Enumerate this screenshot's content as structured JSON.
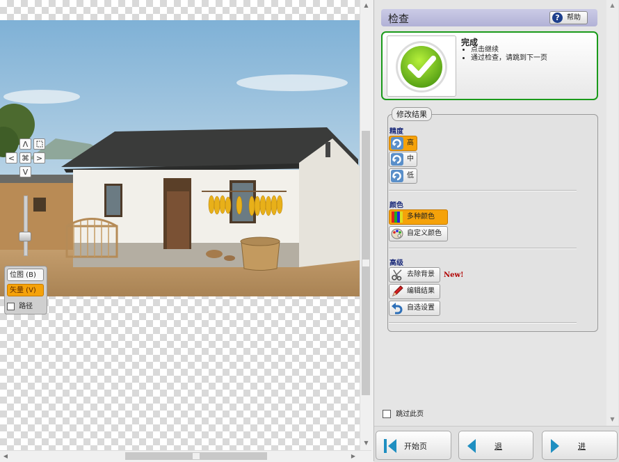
{
  "canvas": {
    "zoom_controls": {
      "up": "Λ",
      "down": "V",
      "left": "<",
      "right": ">",
      "center": "⌘"
    },
    "mode_panel": {
      "bitmap_label": "位图 (B)",
      "vector_label": "矢量 (V)",
      "path_label": "路径"
    }
  },
  "panel": {
    "title": "检查",
    "help_label": "帮助",
    "status": {
      "title": "完成",
      "bullets": [
        "点击继续",
        "通过检查，请跳到下一页"
      ]
    },
    "group_title": "修改结果",
    "precision": {
      "title": "精度",
      "options": [
        "高",
        "中",
        "低"
      ],
      "selected": "高"
    },
    "color": {
      "title": "颜色",
      "options": [
        "多种颜色",
        "自定义颜色"
      ],
      "selected": "多种颜色"
    },
    "advanced": {
      "title": "高级",
      "options": [
        "去除背景",
        "编辑结果",
        "自选设置"
      ],
      "new_badge": "New!"
    },
    "skip_label": "跳过此页",
    "nav": {
      "start_label": "开始页",
      "back_label": "退",
      "next_label": "进"
    }
  },
  "colors": {
    "accent_orange": "#f5a20a",
    "status_green": "#1a9a1a",
    "title_bar": "#c0c0e0",
    "new_red": "#b00000"
  }
}
